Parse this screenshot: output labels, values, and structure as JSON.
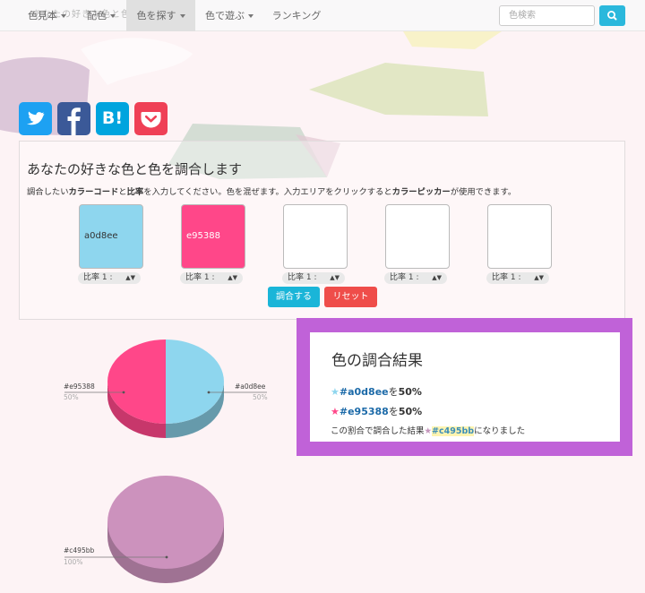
{
  "nav": {
    "ghost_text": "あなたの好きな色と色を調合します",
    "items": [
      {
        "label": "色見本",
        "dropdown": true
      },
      {
        "label": "配色",
        "dropdown": true
      },
      {
        "label": "色を探す",
        "dropdown": true,
        "active": true
      },
      {
        "label": "色で遊ぶ",
        "dropdown": true
      },
      {
        "label": "ランキング",
        "dropdown": false
      }
    ],
    "search_placeholder": "色検索",
    "search_icon": "search-icon"
  },
  "social": [
    {
      "name": "twitter",
      "icon": "twitter-bird-icon",
      "color": "#1da1f2"
    },
    {
      "name": "facebook",
      "icon": "facebook-f-icon",
      "color": "#3b5998"
    },
    {
      "name": "hatena-bookmark",
      "label": "B!",
      "color": "#00a4de"
    },
    {
      "name": "pocket",
      "icon": "pocket-icon",
      "color": "#ef4056"
    }
  ],
  "mixer": {
    "title": "あなたの好きな色と色を調合します",
    "desc_parts": [
      "調合したい",
      "カラーコード",
      "と",
      "比率",
      "を入力してください。色を混ぜます。入力エリアをクリックすると",
      "カラーピッカー",
      "が使用できます。"
    ],
    "swatches": [
      {
        "value": "a0d8ee",
        "color": "#8ed6ee",
        "text_color": "#333"
      },
      {
        "value": "e95388",
        "color": "#ff4789",
        "text_color": "#ffffff"
      },
      {
        "value": "",
        "color": "#ffffff",
        "text_color": "#333"
      },
      {
        "value": "",
        "color": "#ffffff",
        "text_color": "#333"
      },
      {
        "value": "",
        "color": "#ffffff",
        "text_color": "#333"
      }
    ],
    "ratio_label": "比率 1 :",
    "mix_button": "調合する",
    "reset_button": "リセット",
    "mix_color": "#1ab5d8",
    "reset_color": "#ef4d4a"
  },
  "result": {
    "title": "色の調合結果",
    "lines": [
      {
        "star": "★",
        "star_color": "#8ed6ee",
        "hex": "#a0d8ee",
        "suffix_pre": "を",
        "percent": "50%"
      },
      {
        "star": "★",
        "star_color": "#ff4789",
        "hex": "#e95388",
        "suffix_pre": "を",
        "percent": "50%"
      }
    ],
    "summary_pre": "この割合で調合した結果",
    "summary_star": "★",
    "summary_star_color": "#c495bb",
    "summary_hex": "#c495bb",
    "summary_post": "になりました"
  },
  "chart_data": [
    {
      "type": "pie",
      "slices": [
        {
          "label": "#e95388",
          "value": 50,
          "color": "#ff4789",
          "pct_label": "50%"
        },
        {
          "label": "#a0d8ee",
          "value": 50,
          "color": "#8ed6ee",
          "pct_label": "50%"
        }
      ]
    },
    {
      "type": "pie",
      "slices": [
        {
          "label": "#c495bb",
          "value": 100,
          "color": "#cc92bd",
          "pct_label": "100%"
        }
      ]
    }
  ]
}
